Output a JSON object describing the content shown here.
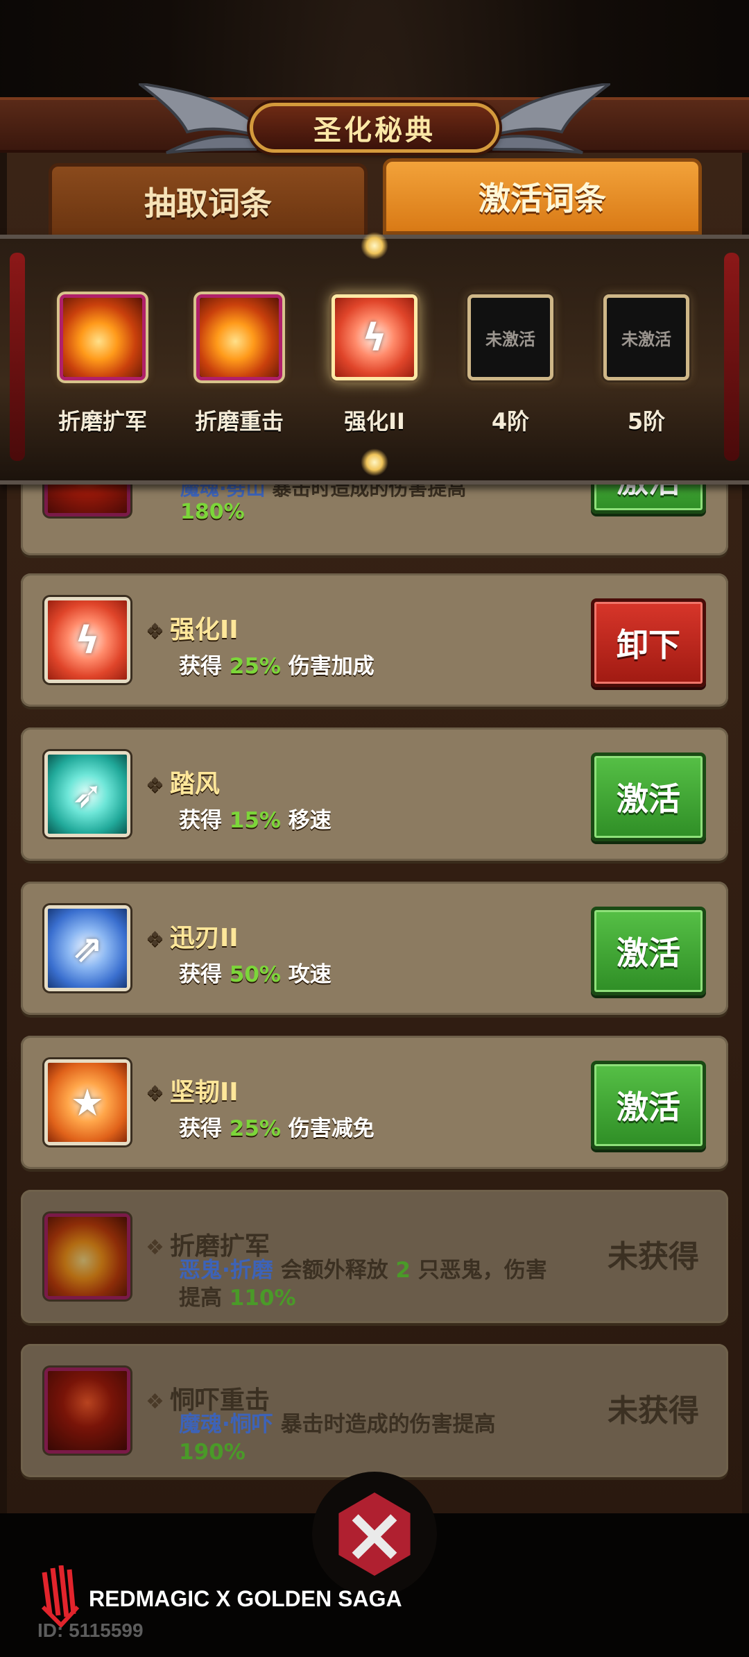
{
  "header": {
    "title": "圣化秘典"
  },
  "tabs": [
    {
      "label": "抽取词条",
      "active": false
    },
    {
      "label": "激活词条",
      "active": true
    }
  ],
  "tiers": [
    {
      "label": "折磨扩军",
      "icon": "fire-beast-icon",
      "state": "filled"
    },
    {
      "label": "折磨重击",
      "icon": "fire-beast-icon",
      "state": "filled"
    },
    {
      "label": "强化II",
      "icon": "red-strike-icon",
      "state": "current"
    },
    {
      "label": "4阶",
      "locked_text": "未激活",
      "state": "locked"
    },
    {
      "label": "5阶",
      "locked_text": "未激活",
      "state": "locked"
    }
  ],
  "partial_card": {
    "keyword": "魔魂·劈山",
    "text": "暴击时造成的伤害提高",
    "value": "180%",
    "button": "激活"
  },
  "cards": [
    {
      "name": "强化II",
      "prefix": "获得",
      "value": "25%",
      "suffix": "伤害加成",
      "button": "卸下",
      "button_style": "red",
      "icon": "red-strike-icon"
    },
    {
      "name": "踏风",
      "prefix": "获得",
      "value": "15%",
      "suffix": "移速",
      "button": "激活",
      "button_style": "green",
      "icon": "wind-boot-icon"
    },
    {
      "name": "迅刃II",
      "prefix": "获得",
      "value": "50%",
      "suffix": "攻速",
      "button": "激活",
      "button_style": "green",
      "icon": "blade-arrows-icon"
    },
    {
      "name": "坚韧II",
      "prefix": "获得",
      "value": "25%",
      "suffix": "伤害减免",
      "button": "激活",
      "button_style": "green",
      "icon": "shield-star-icon"
    }
  ],
  "unacquired_cards": [
    {
      "name": "折磨扩军",
      "keyword": "恶鬼·折磨",
      "text_a": "会额外释放",
      "count": "2",
      "text_b": "只恶鬼，伤害",
      "text_c": "提高",
      "value": "110%",
      "status": "未获得",
      "icon": "fire-beast-icon"
    },
    {
      "name": "恫吓重击",
      "keyword": "魔魂·恫吓",
      "text_a": "暴击时造成的伤害提高",
      "value": "190%",
      "status": "未获得",
      "icon": "demon-face-icon"
    }
  ],
  "watermark": {
    "brand": "REDMAGIC X GOLDEN SAGA",
    "id": "ID: 5115599"
  },
  "colors": {
    "accent_green": "#7cd63a",
    "title_gold": "#ffe79a",
    "button_green": "#3fa52f",
    "button_red": "#c0281e"
  }
}
